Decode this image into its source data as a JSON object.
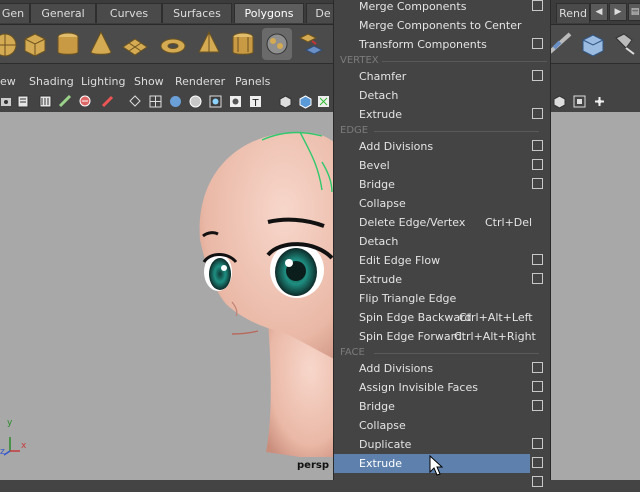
{
  "shelf_tabs": [
    {
      "label": "Gen",
      "active": false
    },
    {
      "label": "General",
      "active": false
    },
    {
      "label": "Curves",
      "active": false
    },
    {
      "label": "Surfaces",
      "active": false
    },
    {
      "label": "Polygons",
      "active": true
    },
    {
      "label": "De",
      "active": false
    },
    {
      "label": "Rend",
      "active": false
    }
  ],
  "panel_menus": [
    "ew",
    "Shading",
    "Lighting",
    "Show",
    "Renderer",
    "Panels"
  ],
  "viewport": {
    "camera_label": "persp",
    "axis_labels": {
      "x": "x",
      "y": "y",
      "z": "z"
    }
  },
  "popup": {
    "items_top": [
      {
        "label": "Merge Components",
        "option": true
      },
      {
        "label": "Merge Components to Center",
        "option": false
      },
      {
        "label": "Transform Components",
        "option": true
      }
    ],
    "sections": [
      {
        "title": "VERTEX",
        "items": [
          {
            "label": "Chamfer",
            "option": true
          },
          {
            "label": "Detach",
            "option": false
          },
          {
            "label": "Extrude",
            "option": true
          }
        ]
      },
      {
        "title": "EDGE",
        "items": [
          {
            "label": "Add Divisions",
            "option": true
          },
          {
            "label": "Bevel",
            "option": true
          },
          {
            "label": "Bridge",
            "option": true
          },
          {
            "label": "Collapse",
            "option": false
          },
          {
            "label": "Delete Edge/Vertex",
            "shortcut": "Ctrl+Del",
            "option": false
          },
          {
            "label": "Detach",
            "option": false
          },
          {
            "label": "Edit Edge Flow",
            "option": true
          },
          {
            "label": "Extrude",
            "option": true
          },
          {
            "label": "Flip Triangle Edge",
            "option": false
          },
          {
            "label": "Spin Edge Backward",
            "shortcut": "Ctrl+Alt+Left",
            "option": false
          },
          {
            "label": "Spin Edge Forward",
            "shortcut": "Ctrl+Alt+Right",
            "option": false
          }
        ]
      },
      {
        "title": "FACE",
        "items": [
          {
            "label": "Add Divisions",
            "option": true
          },
          {
            "label": "Assign Invisible Faces",
            "option": true
          },
          {
            "label": "Bridge",
            "option": true
          },
          {
            "label": "Collapse",
            "option": false
          },
          {
            "label": "Duplicate",
            "option": true
          },
          {
            "label": "Extrude",
            "option": true,
            "highlighted": true
          }
        ]
      }
    ]
  },
  "colors": {
    "highlight": "#5d80ac",
    "menu_bg": "#444444",
    "viewport_bg": "#a8a8a8",
    "skin": "#f2cbbd",
    "eye": "#1f8f82"
  }
}
